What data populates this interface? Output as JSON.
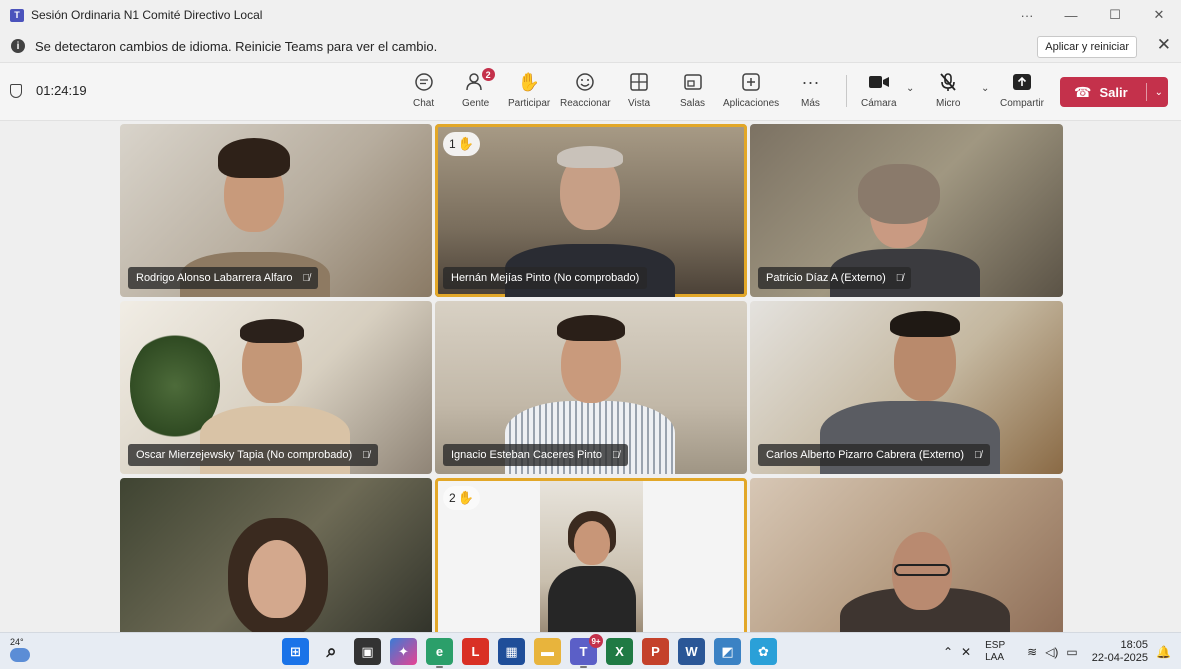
{
  "window": {
    "title": "Sesión Ordinaria N1 Comité Directivo Local",
    "controls": [
      "···",
      "—",
      "☐",
      "✕"
    ]
  },
  "infobar": {
    "message": "Se detectaron cambios de idioma. Reinicie Teams para ver el cambio.",
    "apply_label": "Aplicar y reiniciar"
  },
  "toolbar": {
    "timer": "01:24:19",
    "chat": "Chat",
    "people": "Gente",
    "people_badge": "2",
    "participate": "Participar",
    "react": "Reaccionar",
    "view": "Vista",
    "rooms": "Salas",
    "apps": "Aplicaciones",
    "more": "Más",
    "camera": "Cámara",
    "mic": "Micro",
    "share": "Compartir",
    "leave": "Salir"
  },
  "participants": [
    {
      "name": "Rodrigo Alonso Labarrera Alfaro",
      "muted": true
    },
    {
      "name": "Hernán Mejías Pinto (No comprobado)",
      "muted": false,
      "hand_raised": "1",
      "active": true
    },
    {
      "name": "Patricio Díaz A (Externo)",
      "muted": true
    },
    {
      "name": "Oscar Mierzejewsky Tapia (No comprobado)",
      "muted": true
    },
    {
      "name": "Ignacio Esteban Caceres Pinto",
      "muted": true
    },
    {
      "name": "Carlos Alberto Pizarro Cabrera (Externo)",
      "muted": true
    },
    {
      "name": "",
      "muted": true
    },
    {
      "name": "",
      "muted": true,
      "hand_raised": "2",
      "active": true
    },
    {
      "name": "",
      "muted": true
    }
  ],
  "taskbar": {
    "weather": "24°",
    "teams_badge": "9+",
    "lang_top": "ESP",
    "lang_bottom": "LAA",
    "time": "18:05",
    "date": "22-04-2025"
  },
  "colors": {
    "leave": "#c4314b",
    "active_outline": "#e2a728",
    "badge": "#c4314b"
  }
}
